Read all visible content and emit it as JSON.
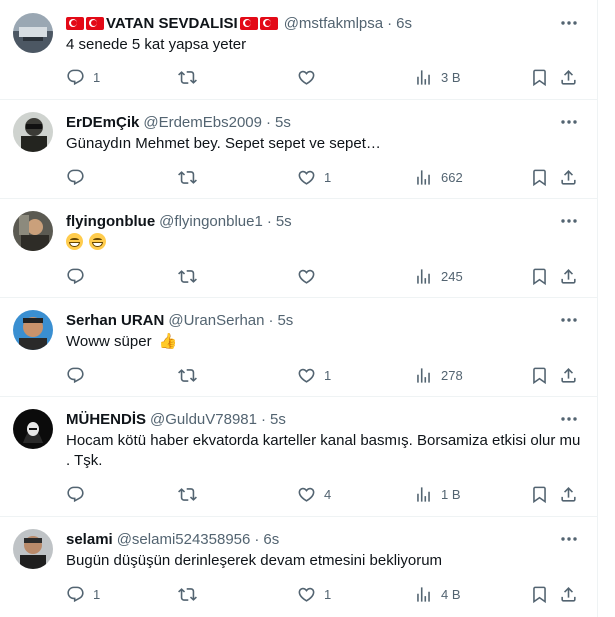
{
  "tweets": [
    {
      "name": "VATAN SEVDALISI",
      "handle": "@mstfakmlpsa",
      "time": "6s",
      "text": "4 senede 5 kat yapsa yeter",
      "replies": "1",
      "retweets": "",
      "likes": "",
      "views": "3 B"
    },
    {
      "name": "ErDEmÇik",
      "handle": "@ErdemEbs2009",
      "time": "5s",
      "text": "Günaydın Mehmet bey. Sepet sepet ve sepet…",
      "replies": "",
      "retweets": "",
      "likes": "1",
      "views": "662"
    },
    {
      "name": "flyingonblue",
      "handle": "@flyingonblue1",
      "time": "5s",
      "text": "",
      "replies": "",
      "retweets": "",
      "likes": "",
      "views": "245"
    },
    {
      "name": "Serhan URAN",
      "handle": "@UranSerhan",
      "time": "5s",
      "text": "Woww süper",
      "replies": "",
      "retweets": "",
      "likes": "1",
      "views": "278"
    },
    {
      "name": "MÜHENDİS",
      "handle": "@GulduV78981",
      "time": "5s",
      "text": "Hocam kötü haber ekvatorda karteller kanal basmış. Borsamiza etkisi olur mu . Tşk.",
      "replies": "",
      "retweets": "",
      "likes": "4",
      "views": "1 B"
    },
    {
      "name": "selami",
      "handle": "@selami524358956",
      "time": "6s",
      "text": "Bugün düşüşün derinleşerek devam etmesini bekliyorum",
      "replies": "1",
      "retweets": "",
      "likes": "1",
      "views": "4 B"
    }
  ],
  "icons": {
    "reply": "reply-icon",
    "retweet": "retweet-icon",
    "like": "like-icon",
    "views": "views-icon",
    "bookmark": "bookmark-icon",
    "share": "share-icon",
    "more": "more-icon"
  },
  "colors": {
    "text": "#0f1419",
    "secondary": "#536471",
    "flag": "#e30a17",
    "border": "#eff3f4"
  }
}
